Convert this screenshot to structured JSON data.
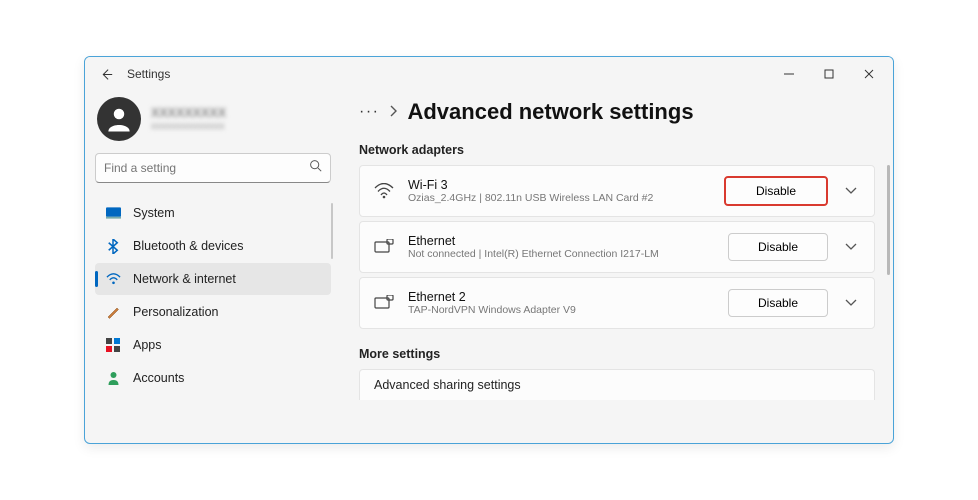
{
  "window": {
    "title": "Settings"
  },
  "profile": {
    "name": "XXXXXXXXX",
    "email": "xxxxxxxxxxxxxx"
  },
  "search": {
    "placeholder": "Find a setting"
  },
  "sidebar": {
    "items": [
      {
        "label": "System"
      },
      {
        "label": "Bluetooth & devices"
      },
      {
        "label": "Network & internet"
      },
      {
        "label": "Personalization"
      },
      {
        "label": "Apps"
      },
      {
        "label": "Accounts"
      }
    ]
  },
  "breadcrumb": {
    "ellipsis": "···",
    "title": "Advanced network settings"
  },
  "sections": {
    "adapters_title": "Network adapters",
    "more_title": "More settings",
    "truncated_item": "Advanced sharing settings"
  },
  "adapters": [
    {
      "name": "Wi-Fi 3",
      "sub": "Ozias_2.4GHz | 802.11n USB Wireless LAN Card #2",
      "button": "Disable"
    },
    {
      "name": "Ethernet",
      "sub": "Not connected | Intel(R) Ethernet Connection I217-LM",
      "button": "Disable"
    },
    {
      "name": "Ethernet 2",
      "sub": "TAP-NordVPN Windows Adapter V9",
      "button": "Disable"
    }
  ]
}
